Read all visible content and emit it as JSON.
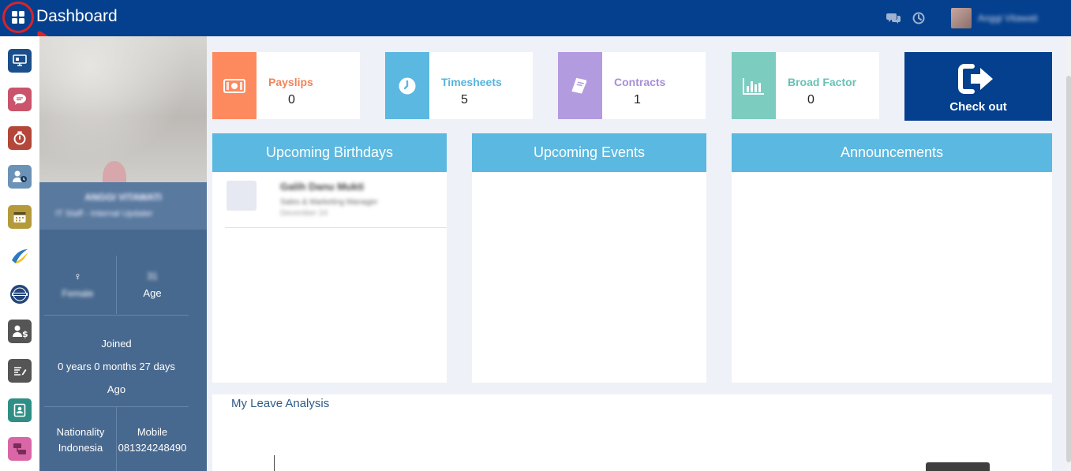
{
  "header": {
    "title": "Dashboard",
    "user_name": "Anggi Vitawati"
  },
  "rail": {
    "items": [
      {
        "name": "dashboard",
        "color": "#1b4f8b"
      },
      {
        "name": "chat",
        "color": "#c9546b"
      },
      {
        "name": "timer",
        "color": "#b4473a"
      },
      {
        "name": "users-time",
        "color": "#6b93b8"
      },
      {
        "name": "calendar",
        "color": "#b59a3c"
      },
      {
        "name": "logo-swoosh",
        "color": "#2d79c2"
      },
      {
        "name": "badge-logo",
        "color": "#23467a"
      },
      {
        "name": "payroll",
        "color": "#555555"
      },
      {
        "name": "notes",
        "color": "#555555"
      },
      {
        "name": "contacts",
        "color": "#2f8f86"
      },
      {
        "name": "modules",
        "color": "#d966a6"
      }
    ]
  },
  "profile": {
    "name": "ANGGI VITAWATI",
    "role": "IT Staff - Internal Updater",
    "gender": "Female",
    "age_value": "31",
    "age_label": "Age",
    "joined_label": "Joined",
    "joined_duration": "0 years 0 months 27 days",
    "joined_suffix": "Ago",
    "nationality_label": "Nationality",
    "nationality_value": "Indonesia",
    "mobile_label": "Mobile",
    "mobile_value": "081324248490"
  },
  "cards": [
    {
      "label": "Payslips",
      "value": "0",
      "color": "#fd8a5e",
      "label_color": "#f0845a"
    },
    {
      "label": "Timesheets",
      "value": "5",
      "color": "#5bb8e0",
      "label_color": "#55b4de"
    },
    {
      "label": "Contracts",
      "value": "1",
      "color": "#b39be0",
      "label_color": "#a58ed8"
    },
    {
      "label": "Broad Factor",
      "value": "0",
      "color": "#7cccc0",
      "label_color": "#66c2b4"
    }
  ],
  "checkout": {
    "label": "Check out"
  },
  "panels": {
    "birthdays": {
      "title": "Upcoming Birthdays",
      "entries": [
        {
          "name": "Galih Danu Mukti",
          "role": "Sales & Marketing Manager",
          "date": "December 24"
        }
      ]
    },
    "events": {
      "title": "Upcoming Events"
    },
    "announcements": {
      "title": "Announcements"
    }
  },
  "leave": {
    "title": "My Leave Analysis"
  }
}
